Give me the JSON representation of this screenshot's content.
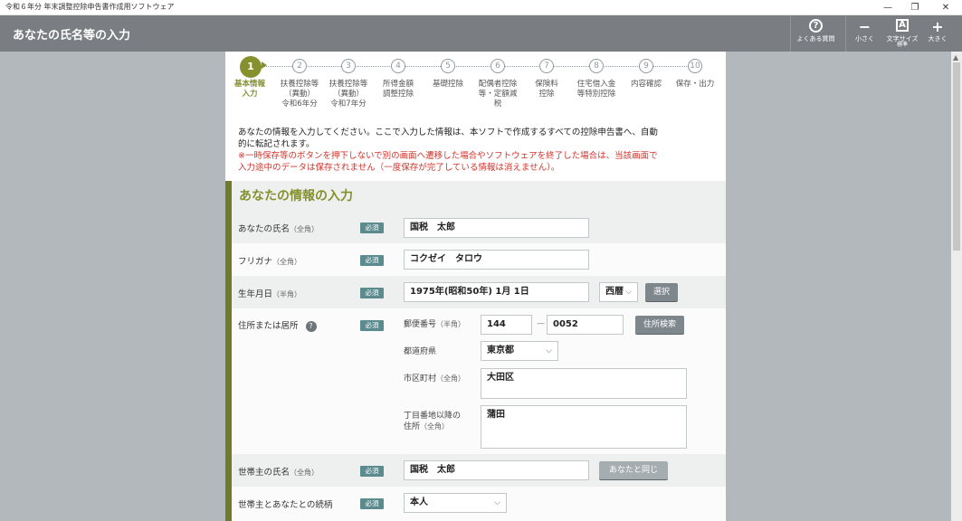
{
  "window": {
    "title": "令和６年分 年末調整控除申告書作成用ソフトウェア",
    "minimize": "—",
    "restore": "❐",
    "close": "✕"
  },
  "header": {
    "title": "あなたの氏名等の入力",
    "faq_label": "よくある質問",
    "smaller_label": "小さく",
    "fontsize_label": "文字サイズ",
    "fontsize_state": "標準",
    "larger_label": "大きく",
    "icons": {
      "faq": "?",
      "smaller": "−",
      "fontsize": "A",
      "larger": "+"
    }
  },
  "steps": [
    {
      "num": "1",
      "label": "基本情報\n入力",
      "active": true
    },
    {
      "num": "②",
      "label": "扶養控除等\n（異動）\n令和6年分",
      "active": false
    },
    {
      "num": "③",
      "label": "扶養控除等\n（異動）\n令和7年分",
      "active": false
    },
    {
      "num": "④",
      "label": "所得金額\n調整控除",
      "active": false
    },
    {
      "num": "⑤",
      "label": "基礎控除",
      "active": false
    },
    {
      "num": "⑥",
      "label": "配偶者控除\n等・定額減\n税",
      "active": false
    },
    {
      "num": "⑦",
      "label": "保険料\n控除",
      "active": false
    },
    {
      "num": "⑧",
      "label": "住宅借入金\n等特別控除",
      "active": false
    },
    {
      "num": "⑨",
      "label": "内容確認",
      "active": false
    },
    {
      "num": "⑩",
      "label": "保存・出力",
      "active": false
    }
  ],
  "intro": {
    "text": "あなたの情報を入力してください。ここで入力した情報は、本ソフトで作成するすべての控除申告書へ、自動的に転記されます。",
    "warning": "※一時保存等のボタンを押下しないで別の画面へ遷移した場合やソフトウェアを終了した場合は、当該画面で入力途中のデータは保存されません（一度保存が完了している情報は消えません）。"
  },
  "section": {
    "title": "あなたの情報の入力",
    "required": "必須",
    "name": {
      "label": "あなたの氏名",
      "hint": "（全角）",
      "value": "国税　太郎"
    },
    "kana": {
      "label": "フリガナ",
      "hint": "（全角）",
      "value": "コクゼイ　タロウ"
    },
    "birth": {
      "label": "生年月日",
      "hint": "（半角）",
      "value": "1975年(昭和50年) 1月 1日",
      "era": "西暦",
      "select_button": "選択"
    },
    "address": {
      "label": "住所または居所",
      "help": "?",
      "postal_label": "郵便番号",
      "postal_hint": "（半角）",
      "postal1": "144",
      "postal_dash": "—",
      "postal2": "0052",
      "search_button": "住所検索",
      "pref_label": "都道府県",
      "pref_value": "東京都",
      "city_label": "市区町村",
      "city_hint": "（全角）",
      "city_value": "大田区",
      "street_label": "丁目番地以降の\n住所",
      "street_hint": "（全角）",
      "street_value": "蒲田"
    },
    "householder": {
      "label": "世帯主の氏名",
      "hint": "（全角）",
      "value": "国税　太郎",
      "same_button": "あなたと同じ"
    },
    "relation": {
      "label": "世帯主とあなたとの続柄",
      "value": "本人"
    }
  }
}
